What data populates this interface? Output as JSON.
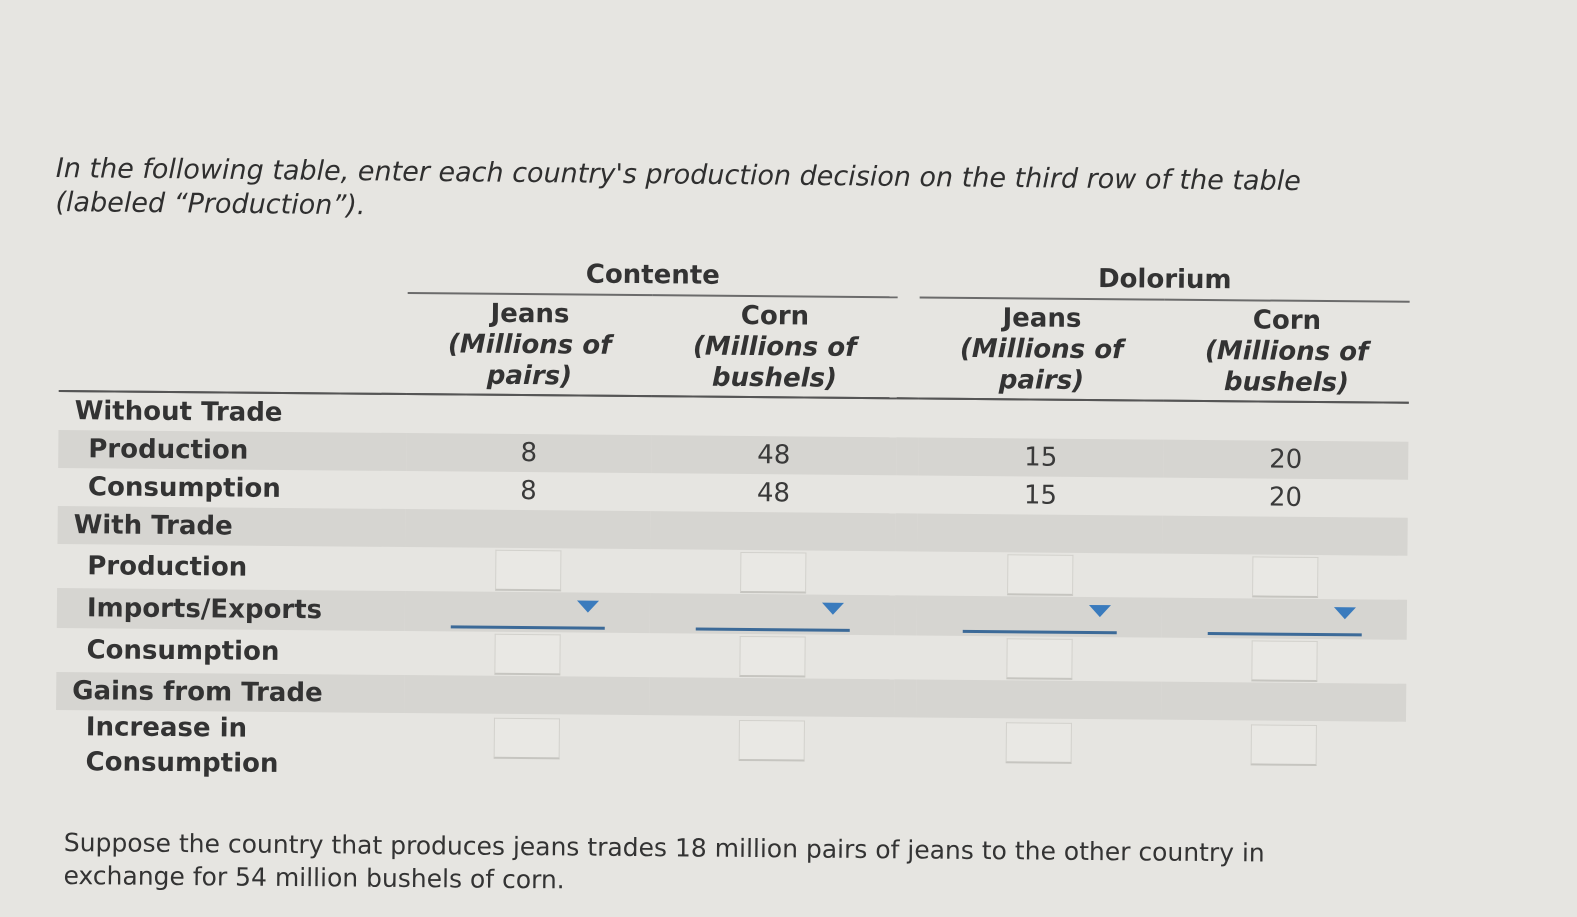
{
  "instructions": {
    "intro": "In the following table, enter each country's production decision on the third row of the table (labeled “Production”).",
    "outro": "Suppose the country that produces jeans trades 18 million pairs of jeans to the other country in exchange for 54 million bushels of corn."
  },
  "table": {
    "countries": [
      "Contente",
      "Dolorium"
    ],
    "columns": [
      {
        "good": "Jeans",
        "unit": "(Millions of pairs)",
        "country": "Contente"
      },
      {
        "good": "Corn",
        "unit": "(Millions of bushels)",
        "country": "Contente"
      },
      {
        "good": "Jeans",
        "unit": "(Millions of pairs)",
        "country": "Dolorium"
      },
      {
        "good": "Corn",
        "unit": "(Millions of bushels)",
        "country": "Dolorium"
      }
    ],
    "sections": {
      "without_trade": "Without Trade",
      "with_trade": "With Trade",
      "gains": "Gains from Trade"
    },
    "rows": {
      "wt_production": {
        "label": "Production",
        "values": [
          "8",
          "48",
          "15",
          "20"
        ]
      },
      "wt_consumption": {
        "label": "Consumption",
        "values": [
          "8",
          "48",
          "15",
          "20"
        ]
      },
      "t_production": {
        "label": "Production",
        "values": [
          "",
          "",
          "",
          ""
        ]
      },
      "t_imports_exports": {
        "label": "Imports/Exports",
        "values": [
          "",
          "",
          "",
          ""
        ]
      },
      "t_consumption": {
        "label": "Consumption",
        "values": [
          "",
          "",
          "",
          ""
        ]
      },
      "increase": {
        "label_line1": "Increase in",
        "label_line2": "Consumption",
        "values": [
          "",
          "",
          "",
          ""
        ]
      }
    }
  },
  "colors": {
    "background": "#e6e5e1",
    "shade": "#d6d5d1",
    "select_accent": "#3a7bbd"
  }
}
